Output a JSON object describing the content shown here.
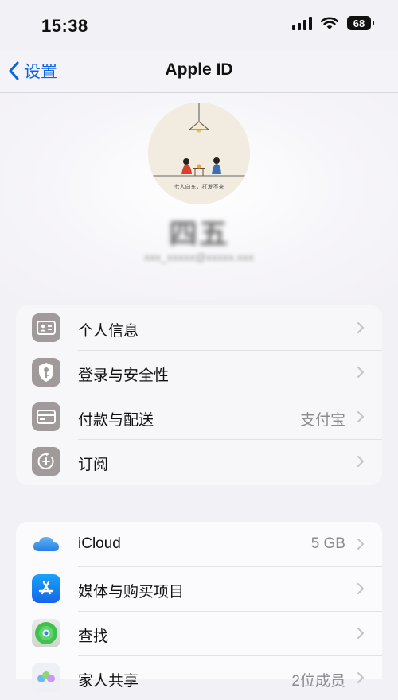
{
  "status_bar": {
    "time": "15:38",
    "battery": "68"
  },
  "nav": {
    "back_label": "设置",
    "title": "Apple ID"
  },
  "profile": {
    "avatar_caption": "七人向东，打发不来",
    "name": "四五",
    "email": "xxx_xxxxx@xxxxx.xxx"
  },
  "groups": [
    {
      "items": [
        {
          "label": "个人信息",
          "value": "",
          "icon": "id-card-icon"
        },
        {
          "label": "登录与安全性",
          "value": "",
          "icon": "key-shield-icon"
        },
        {
          "label": "付款与配送",
          "value": "支付宝",
          "icon": "credit-card-icon"
        },
        {
          "label": "订阅",
          "value": "",
          "icon": "subscription-icon"
        }
      ]
    },
    {
      "items": [
        {
          "label": "iCloud",
          "value": "5 GB",
          "icon": "icloud-icon"
        },
        {
          "label": "媒体与购买项目",
          "value": "",
          "icon": "app-store-icon"
        },
        {
          "label": "查找",
          "value": "",
          "icon": "find-my-icon"
        },
        {
          "label": "家人共享",
          "value": "2位成员",
          "icon": "family-sharing-icon"
        }
      ]
    }
  ],
  "colors": {
    "accent": "#0a64e5",
    "background": "#f2f1f6",
    "row_icon_gray": "#a19a9a",
    "secondary_text": "#8a8a8f"
  }
}
